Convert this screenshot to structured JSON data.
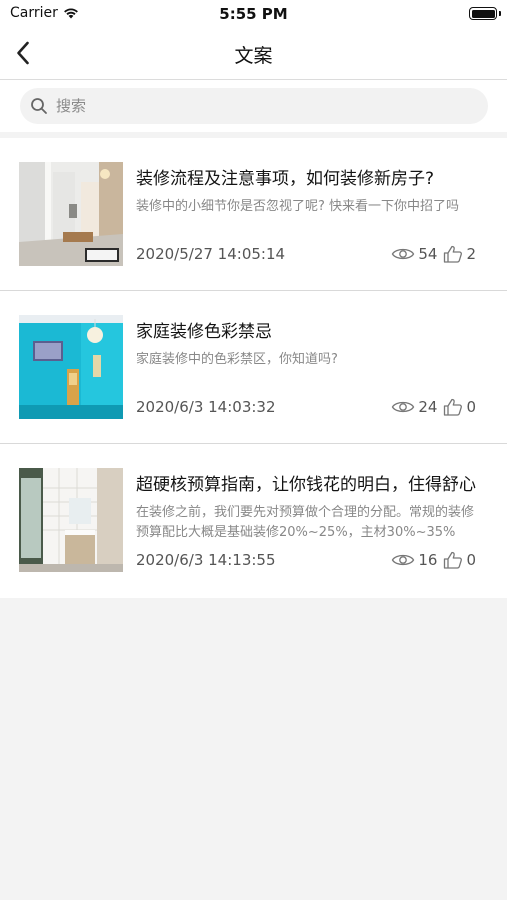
{
  "status_bar": {
    "carrier": "Carrier",
    "time": "5:55 PM"
  },
  "nav": {
    "title": "文案",
    "back_icon": "chevron-left-icon"
  },
  "search": {
    "placeholder": "搜索",
    "icon": "search-icon"
  },
  "articles": [
    {
      "title": "装修流程及注意事项，如何装修新房子?",
      "summary": "装修中的小细节你是否忽视了呢? 快来看一下你中招了吗",
      "date": "2020/5/27 14:05:14",
      "views": "54",
      "likes": "2"
    },
    {
      "title": "家庭装修色彩禁忌",
      "summary": "家庭装修中的色彩禁区，你知道吗?",
      "date": "2020/6/3 14:03:32",
      "views": "24",
      "likes": "0"
    },
    {
      "title": "超硬核预算指南，让你钱花的明白，住得舒心",
      "summary": "在装修之前，我们要先对预算做个合理的分配。常规的装修预算配比大概是基础装修20%~25%，主材30%~35%",
      "date": "2020/6/3 14:13:55",
      "views": "16",
      "likes": "0"
    }
  ]
}
